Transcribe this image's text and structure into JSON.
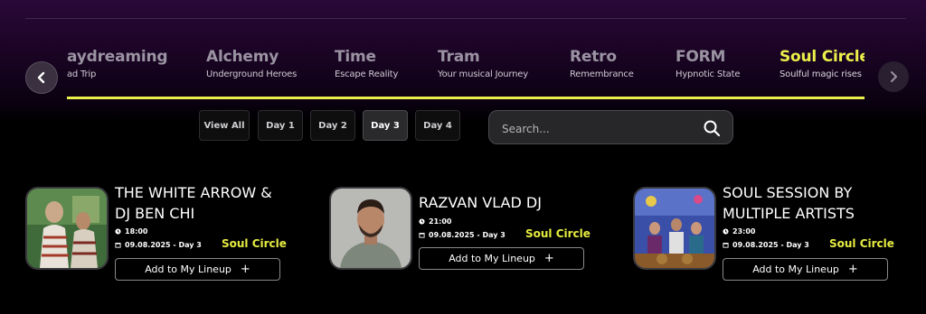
{
  "stages": [
    {
      "name": "aydreaming",
      "sub": "ad Trip"
    },
    {
      "name": "Alchemy",
      "sub": "Underground Heroes"
    },
    {
      "name": "Time",
      "sub": "Escape Reality"
    },
    {
      "name": "Tram",
      "sub": "Your musical Journey"
    },
    {
      "name": "Retro",
      "sub": "Remembrance"
    },
    {
      "name": "FORM",
      "sub": "Hypnotic State"
    },
    {
      "name": "Soul Circle",
      "sub": "Soulful magic rises"
    }
  ],
  "days": {
    "all": "View All",
    "d1": "Day 1",
    "d2": "Day 2",
    "d3": "Day 3",
    "d4": "Day 4"
  },
  "search": {
    "placeholder": "Search..."
  },
  "events": [
    {
      "title1": "THE WHITE ARROW &",
      "title2": "DJ BEN CHI",
      "time": "18:00",
      "date": "09.08.2025 - Day 3",
      "stage": "Soul Circle",
      "button": "Add to My Lineup"
    },
    {
      "title1": "RAZVAN VLAD DJ",
      "title2": "",
      "time": "21:00",
      "date": "09.08.2025 - Day 3",
      "stage": "Soul Circle",
      "button": "Add to My Lineup"
    },
    {
      "title1": "SOUL SESSION BY",
      "title2": "MULTIPLE ARTISTS",
      "time": "23:00",
      "date": "09.08.2025 - Day 3",
      "stage": "Soul Circle",
      "button": "Add to My Lineup"
    }
  ],
  "colors": {
    "accent": "#e8ef4c",
    "background": "#000000",
    "header_purple": "#2a0838"
  },
  "icons": {
    "prev": "chevron-left-icon",
    "next": "chevron-right-icon",
    "search": "search-icon",
    "time": "clock-icon",
    "date": "calendar-icon",
    "add": "plus-icon"
  }
}
